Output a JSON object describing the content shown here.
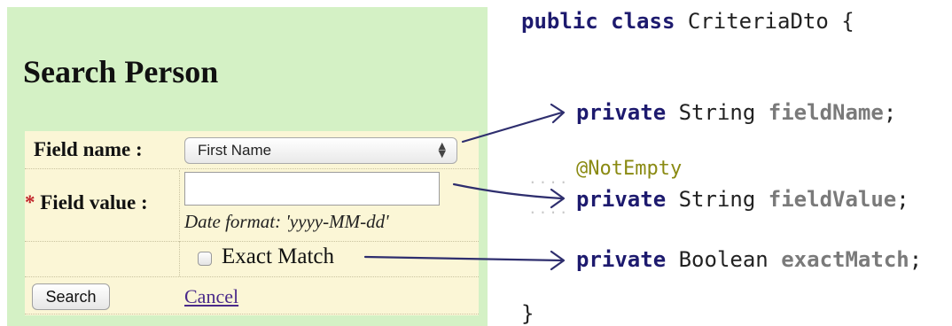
{
  "form": {
    "title": "Search Person",
    "field_name_label": "Field name :",
    "field_name_selected": "First Name",
    "required_marker": "*",
    "field_value_label": "Field value :",
    "field_value_value": "",
    "date_hint": "Date format: 'yyyy-MM-dd'",
    "exact_match_label": "Exact Match",
    "exact_match_checked": false,
    "search_button": "Search",
    "cancel_link": "Cancel"
  },
  "code": {
    "class_decl": {
      "kw1": "public",
      "kw2": "class",
      "name": "CriteriaDto",
      "brace": "{"
    },
    "annotation": "@NotEmpty",
    "fields": [
      {
        "modifier": "private",
        "type": "String",
        "name": "fieldName",
        "end": ";"
      },
      {
        "modifier": "private",
        "type": "String",
        "name": "fieldValue",
        "end": ";"
      },
      {
        "modifier": "private",
        "type": "Boolean",
        "name": "exactMatch",
        "end": ";"
      }
    ],
    "closing_brace": "}"
  },
  "colors": {
    "panel_bg": "#d4f1c5",
    "form_bg": "#fbf6d6",
    "required": "#c0242a",
    "keyword": "#1d1a6e",
    "field_name": "#7a7a7a",
    "annotation": "#8a8a12",
    "arrow": "#2e2e6e"
  },
  "icons": [
    "select-arrows-icon",
    "arrow-icon"
  ]
}
